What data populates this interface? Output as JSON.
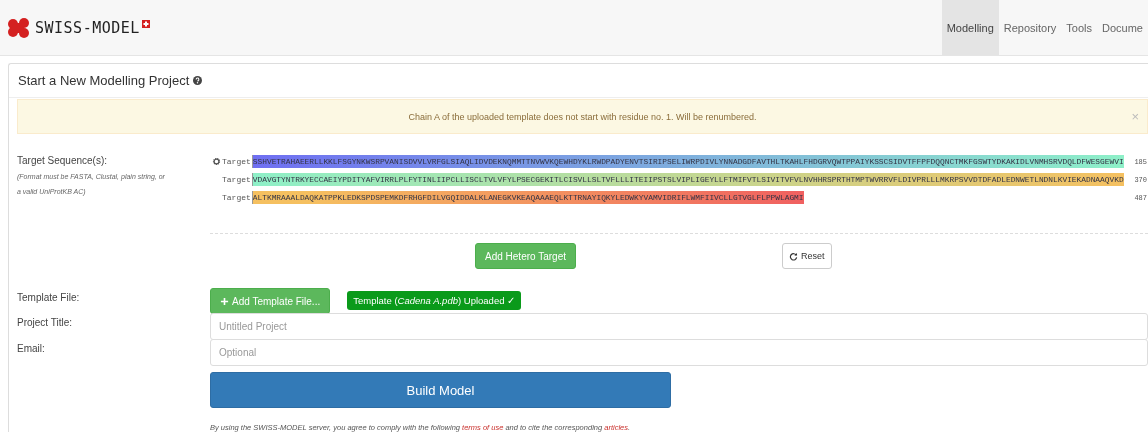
{
  "header": {
    "brand": "SWISS-MODEL",
    "nav": [
      {
        "label": "Modelling",
        "selected": true
      },
      {
        "label": "Repository",
        "selected": false
      },
      {
        "label": "Tools",
        "selected": false
      },
      {
        "label": "Docume",
        "selected": false
      }
    ]
  },
  "panel": {
    "title": "Start a New Modelling Project",
    "alert": {
      "text": "Chain A of the uploaded template does not start with residue no. 1. Will be renumbered.",
      "close": "×"
    },
    "target": {
      "label": "Target Sequence(s):",
      "hint": "(Format must be FASTA, Clustal, plain string, or a valid UniProtKB AC)",
      "rows": [
        {
          "label": "Target",
          "sequence": "SSHVETRAHAEERLLKKLFSGYNKWSRPVANISDVVLVRFGLSIAQLIDVDEKNQMMTTNVWVKQEWHDYKLRWDPADYENVTSIRIPSELIWRPDIVLYNNADGDFAVTHLTKAHLFHDGRVQWTPPAIYKSSCSIDVTFFPFDQQNCTMKFGSWTYDKAKIDLVNMHSRVDQLDFWESGEWVI",
          "end": "185",
          "color": "#6f6ff2"
        },
        {
          "label": "Target",
          "sequence": "VDAVGTYNTRKYECCAEIYPDITYAFVIRRLPLFYTINLIIPCLLISCLTVLVFYLPSECGEKITLCISVLLSLTVFLLLITEIIPSTSLVIPLIGEYLLFTMIFVTLSIVITVFVLNVHHRSPRTHTMPTWVRRVFLDIVPRLLLMKRPSVVDTDFADLEDNWETLNDNLKVIEKADNAAQVKD",
          "end": "370",
          "color": "#8ef0c8"
        },
        {
          "label": "Target",
          "sequence": "ALTKMRAAALDAQKATPPKLEDKSPDSPEMKDFRHGFDILVGQIDDALKLANEGKVKEAQAAAEQLKTTRNAYIQKYLEDWKYVAMVIDRIFLWMFIIVCLLGTVGLFLPPWLAGMI",
          "end": "487",
          "color": "#f5c060"
        }
      ],
      "add_button": "Add Hetero Target",
      "reset_button": "Reset"
    },
    "template": {
      "label": "Template File:",
      "button": "Add Template File...",
      "status": "Template (*Cadena A.pdb*) Uploaded ✓"
    },
    "project": {
      "label": "Project Title:",
      "placeholder": "Untitled Project"
    },
    "email": {
      "label": "Email:",
      "placeholder": "Optional"
    },
    "build_button": "Build Model",
    "footer": {
      "before": "By using the SWISS-MODEL server, you agree to comply with the following",
      "link1": "terms of use",
      "middle": "and to cite the corresponding",
      "link2": "articles",
      "after": "."
    }
  }
}
